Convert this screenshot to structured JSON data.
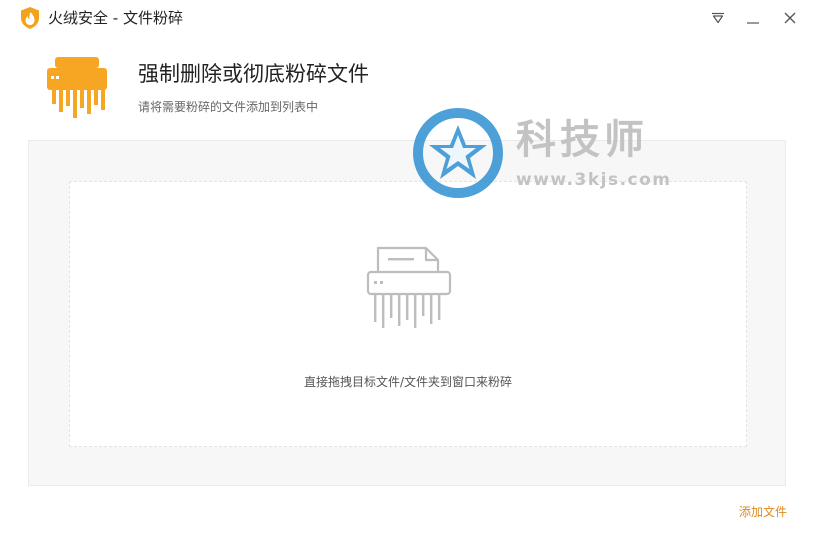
{
  "window": {
    "title": "火绒安全 - 文件粉碎",
    "icons": {
      "app": "huorong-flame-shield-icon",
      "menu": "triangle-down-menu-icon",
      "minimize": "minimize-icon",
      "close": "close-icon"
    }
  },
  "header": {
    "title": "强制删除或彻底粉碎文件",
    "subtitle": "请将需要粉碎的文件添加到列表中",
    "icon": "shredder-icon"
  },
  "drop_zone": {
    "hint": "直接拖拽目标文件/文件夹到窗口来粉碎",
    "icon": "shredder-outline-icon"
  },
  "watermark": {
    "brand": "科技师",
    "url": "www.3kjs.com",
    "icon": "star-badge-icon"
  },
  "footer": {
    "add_files_label": "添加文件"
  },
  "colors": {
    "accent_orange": "#f6a623",
    "link_orange": "#e0891f",
    "watermark_blue": "#2e8fd1",
    "panel_bg": "#f7f7f7"
  }
}
